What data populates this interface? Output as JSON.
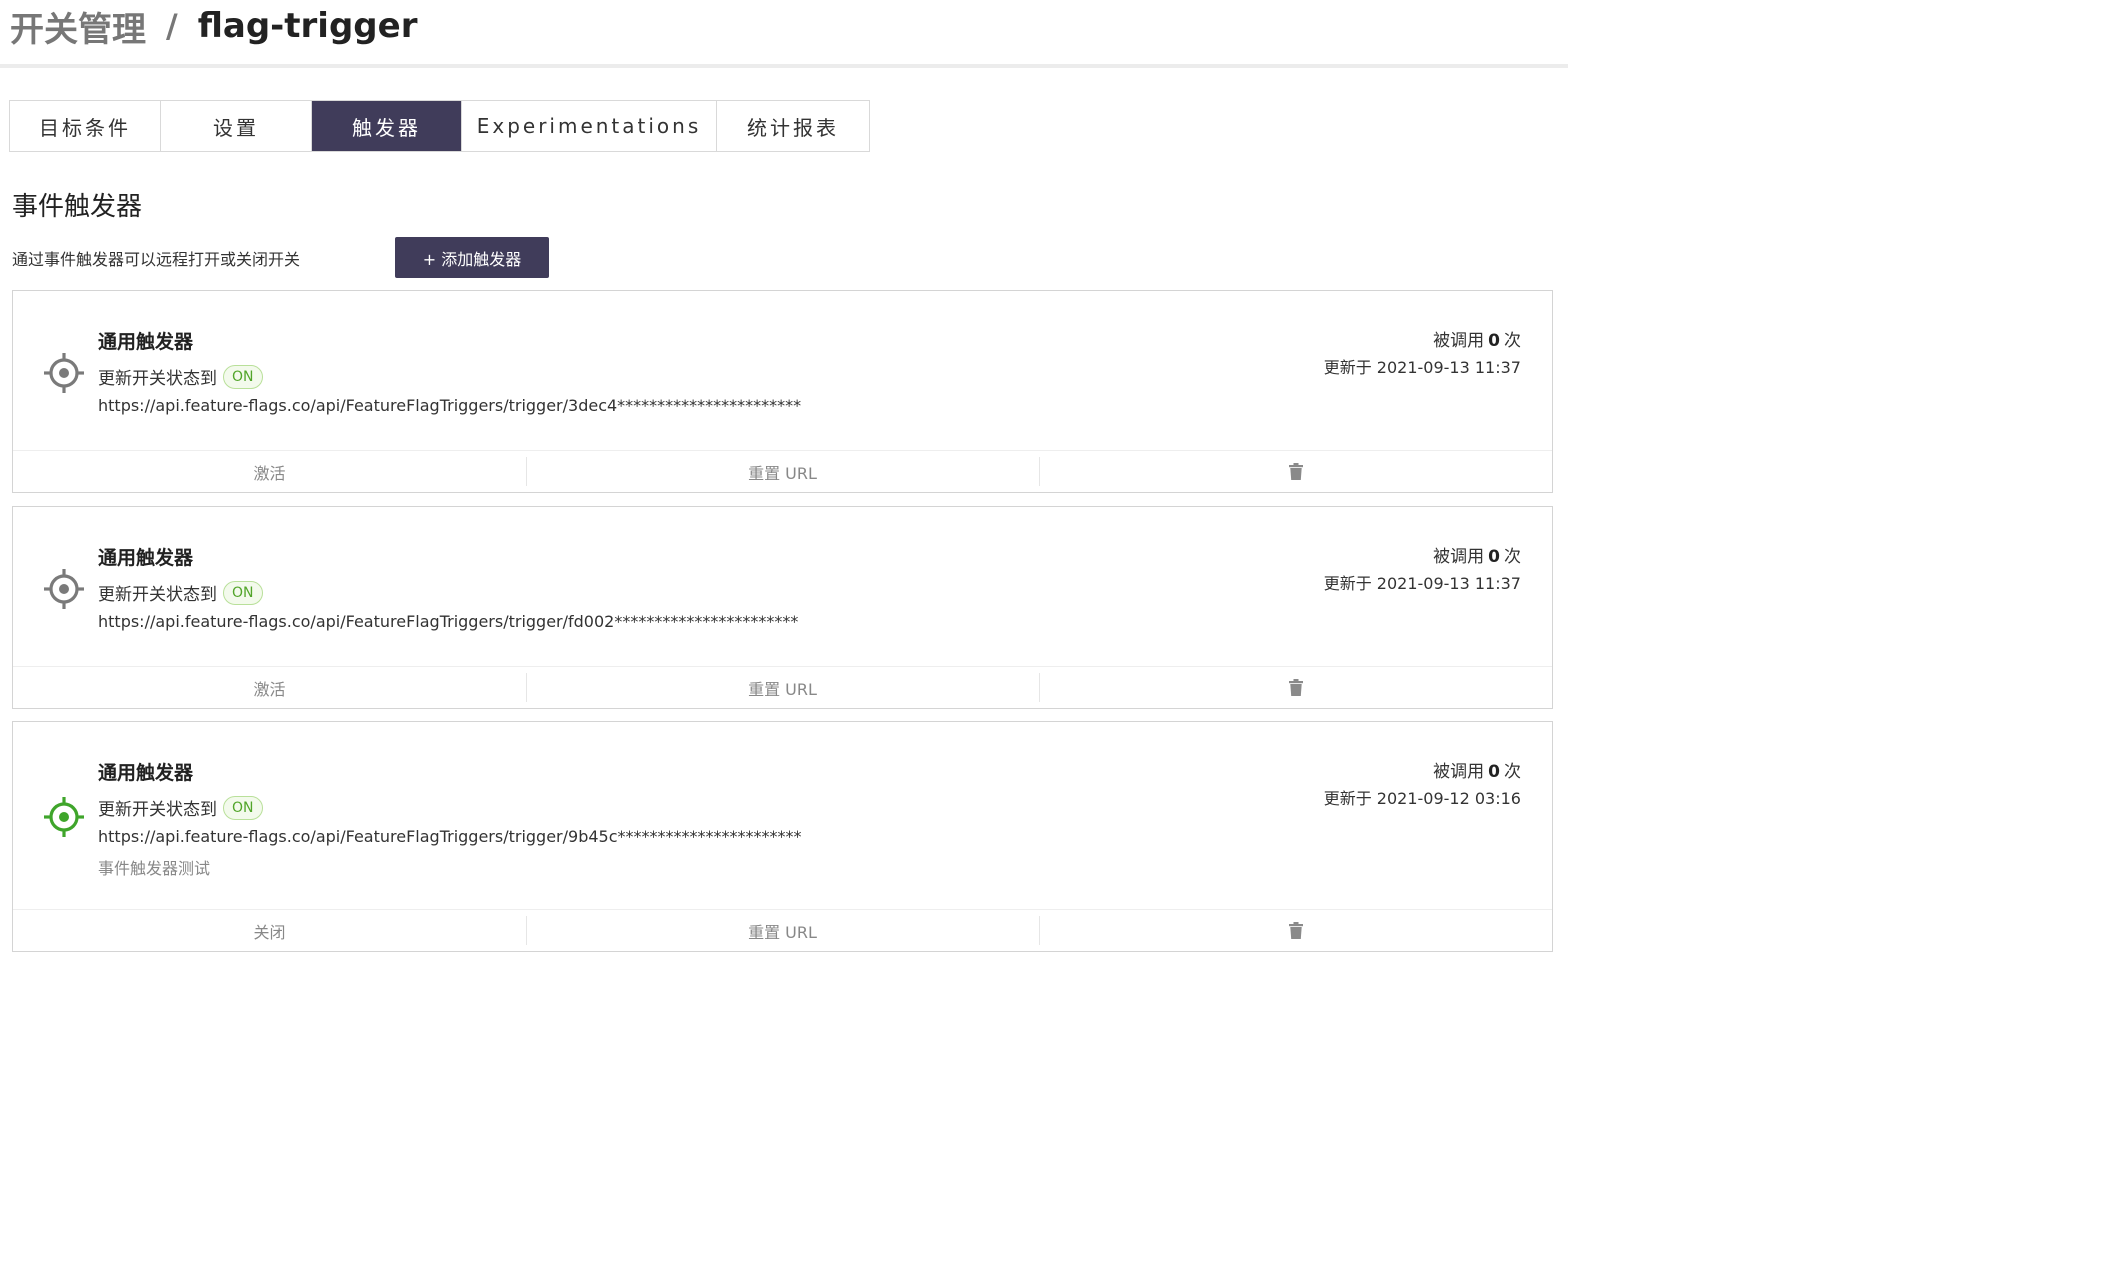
{
  "breadcrumb": {
    "parent": "开关管理",
    "separator": "/",
    "current": "flag-trigger"
  },
  "tabs": [
    {
      "label": "目标条件",
      "active": false
    },
    {
      "label": "设置",
      "active": false
    },
    {
      "label": "触发器",
      "active": true
    },
    {
      "label": "Experimentations",
      "active": false
    },
    {
      "label": "统计报表",
      "active": false
    }
  ],
  "section": {
    "title": "事件触发器",
    "description": "通过事件触发器可以远程打开或关闭开关",
    "add_button": "+ 添加触发器"
  },
  "colors": {
    "accent": "#403c5a",
    "active_icon": "#3fa52b",
    "inactive_icon": "#7a7a7a",
    "on_badge": "#52a52a"
  },
  "triggers": [
    {
      "name": "通用触发器",
      "status_label": "更新开关状态到",
      "status_badge": "ON",
      "url": "https://api.feature-flags.co/api/FeatureFlagTriggers/trigger/3dec4***********************",
      "note": "",
      "calls_prefix": "被调用",
      "calls_count": "0",
      "calls_suffix": "次",
      "updated": "更新于 2021-09-13 11:37",
      "icon": "target-icon",
      "active": false,
      "actions": {
        "toggle": "激活",
        "reset": "重置 URL",
        "delete_icon": "trash-icon"
      }
    },
    {
      "name": "通用触发器",
      "status_label": "更新开关状态到",
      "status_badge": "ON",
      "url": "https://api.feature-flags.co/api/FeatureFlagTriggers/trigger/fd002***********************",
      "note": "",
      "calls_prefix": "被调用",
      "calls_count": "0",
      "calls_suffix": "次",
      "updated": "更新于 2021-09-13 11:37",
      "icon": "target-icon",
      "active": false,
      "actions": {
        "toggle": "激活",
        "reset": "重置 URL",
        "delete_icon": "trash-icon"
      }
    },
    {
      "name": "通用触发器",
      "status_label": "更新开关状态到",
      "status_badge": "ON",
      "url": "https://api.feature-flags.co/api/FeatureFlagTriggers/trigger/9b45c***********************",
      "note": "事件触发器测试",
      "calls_prefix": "被调用",
      "calls_count": "0",
      "calls_suffix": "次",
      "updated": "更新于 2021-09-12 03:16",
      "icon": "target-icon",
      "active": true,
      "actions": {
        "toggle": "关闭",
        "reset": "重置 URL",
        "delete_icon": "trash-icon"
      }
    }
  ]
}
